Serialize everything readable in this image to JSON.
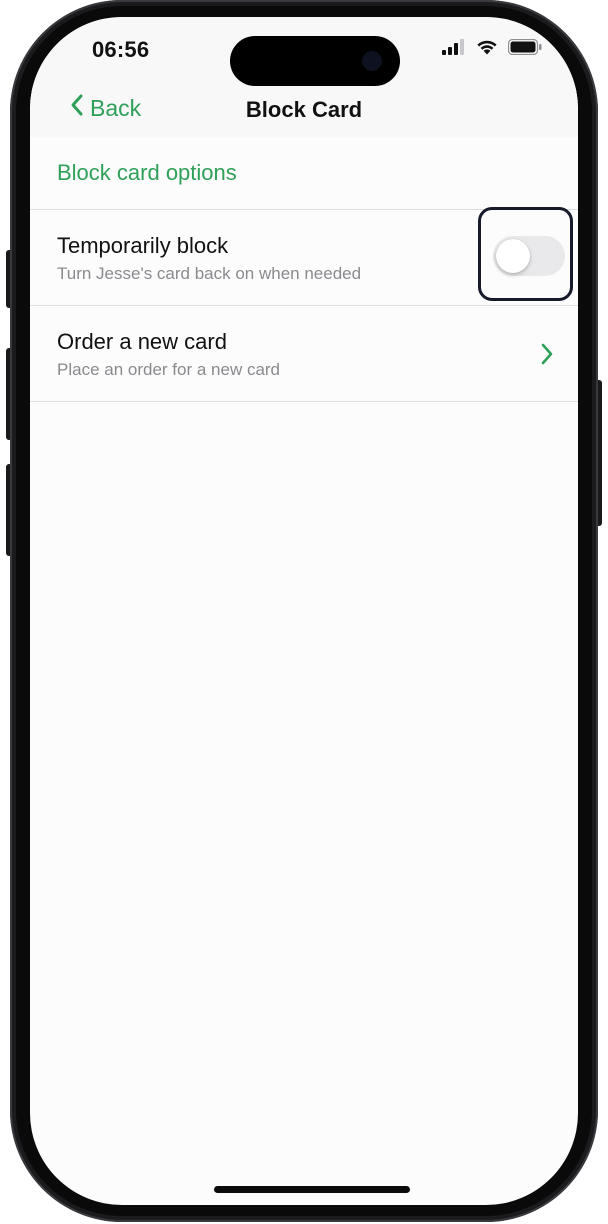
{
  "status_bar": {
    "time": "06:56",
    "signal_icon": "cellular-signal-icon",
    "wifi_icon": "wifi-icon",
    "battery_icon": "battery-icon"
  },
  "nav": {
    "back_label": "Back",
    "back_icon": "chevron-left-icon",
    "title": "Block Card"
  },
  "section": {
    "header": "Block card options"
  },
  "options": [
    {
      "title": "Temporarily block",
      "subtitle": "Turn Jesse's card back on when needed",
      "control": "toggle",
      "toggle_on": false
    },
    {
      "title": "Order a new card",
      "subtitle": "Place an order for a new card",
      "control": "chevron-right-icon"
    }
  ],
  "colors": {
    "accent": "#2ea058",
    "text_primary": "#111111",
    "text_secondary": "#8a8a8e",
    "highlight_border": "#161a2b"
  }
}
